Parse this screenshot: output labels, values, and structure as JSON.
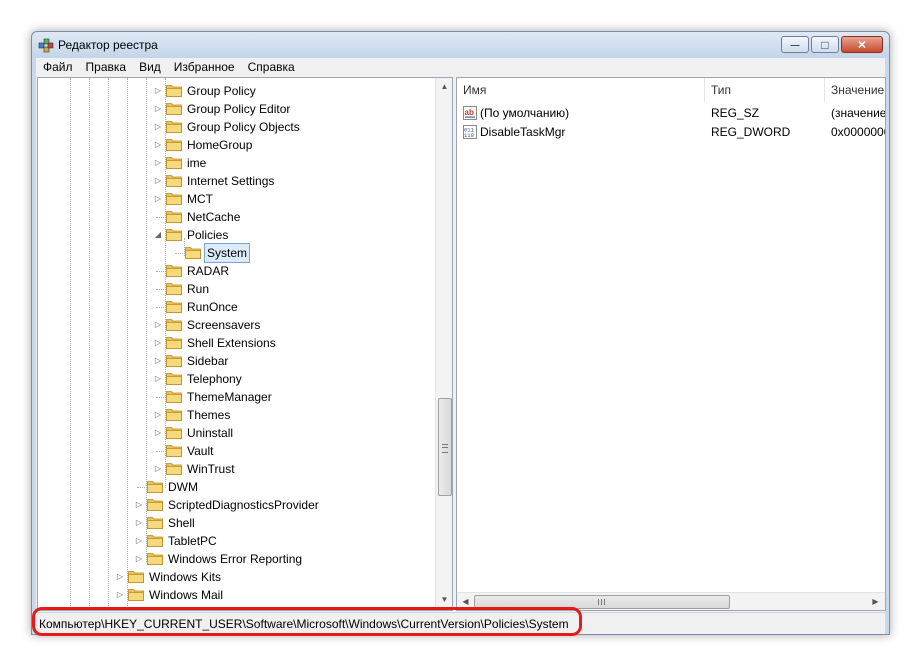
{
  "window": {
    "title": "Редактор реестра",
    "minimize_glyph": "—",
    "maximize_glyph": "□",
    "close_glyph": "✕"
  },
  "menu": [
    "Файл",
    "Правка",
    "Вид",
    "Избранное",
    "Справка"
  ],
  "tree": {
    "nodes": [
      {
        "label": "Group Policy",
        "expander": "▷"
      },
      {
        "label": "Group Policy Editor",
        "expander": "▷"
      },
      {
        "label": "Group Policy Objects",
        "expander": "▷"
      },
      {
        "label": "HomeGroup",
        "expander": "▷"
      },
      {
        "label": "ime",
        "expander": "▷"
      },
      {
        "label": "Internet Settings",
        "expander": "▷"
      },
      {
        "label": "MCT",
        "expander": "▷"
      },
      {
        "label": "NetCache",
        "expander": ""
      },
      {
        "label": "Policies",
        "expander": "◢"
      },
      {
        "label": "System",
        "expander": ""
      },
      {
        "label": "RADAR",
        "expander": ""
      },
      {
        "label": "Run",
        "expander": ""
      },
      {
        "label": "RunOnce",
        "expander": ""
      },
      {
        "label": "Screensavers",
        "expander": "▷"
      },
      {
        "label": "Shell Extensions",
        "expander": "▷"
      },
      {
        "label": "Sidebar",
        "expander": "▷"
      },
      {
        "label": "Telephony",
        "expander": "▷"
      },
      {
        "label": "ThemeManager",
        "expander": ""
      },
      {
        "label": "Themes",
        "expander": "▷"
      },
      {
        "label": "Uninstall",
        "expander": "▷"
      },
      {
        "label": "Vault",
        "expander": ""
      },
      {
        "label": "WinTrust",
        "expander": "▷"
      },
      {
        "label": "DWM",
        "expander": ""
      },
      {
        "label": "ScriptedDiagnosticsProvider",
        "expander": "▷"
      },
      {
        "label": "Shell",
        "expander": "▷"
      },
      {
        "label": "TabletPC",
        "expander": "▷"
      },
      {
        "label": "Windows Error Reporting",
        "expander": "▷"
      },
      {
        "label": "Windows Kits",
        "expander": "▷"
      },
      {
        "label": "Windows Mail",
        "expander": "▷"
      }
    ],
    "scroll_up_glyph": "▲",
    "scroll_down_glyph": "▼"
  },
  "list": {
    "columns": [
      "Имя",
      "Тип",
      "Значение"
    ],
    "rows": [
      {
        "name": "(По умолчанию)",
        "type": "REG_SZ",
        "value": "(значение",
        "icon": "string-value-icon"
      },
      {
        "name": "DisableTaskMgr",
        "type": "REG_DWORD",
        "value": "0x0000000",
        "icon": "dword-value-icon"
      }
    ],
    "scroll_left_glyph": "◀",
    "scroll_right_glyph": "▶"
  },
  "status": {
    "path": "Компьютер\\HKEY_CURRENT_USER\\Software\\Microsoft\\Windows\\CurrentVersion\\Policies\\System"
  },
  "colors": {
    "selection_bg": "#dcebfc",
    "highlight_frame": "#e41b1b"
  }
}
